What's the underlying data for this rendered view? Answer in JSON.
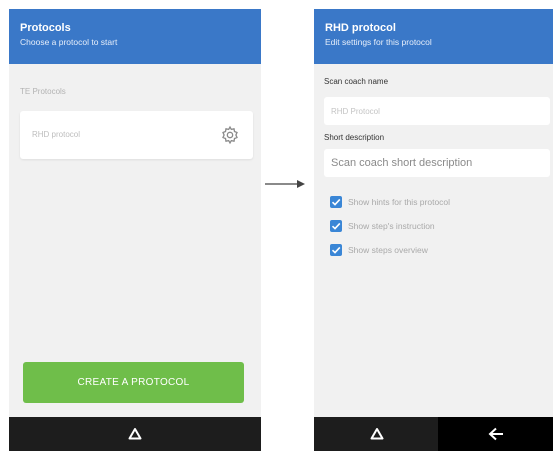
{
  "left_screen": {
    "appbar": {
      "title": "Protocols",
      "subtitle": "Choose a protocol to start"
    },
    "section_label": "TE Protocols",
    "protocol_card": {
      "name": "RHD protocol",
      "icon": "gear-icon"
    },
    "create_button_label": "CREATE A PROTOCOL",
    "navbar": {
      "home_icon": "home-icon"
    }
  },
  "transition_arrow": {
    "icon": "arrow-right-icon"
  },
  "right_screen": {
    "appbar": {
      "title": "RHD protocol",
      "subtitle": "Edit settings for this protocol"
    },
    "scan_coach_name": {
      "label": "Scan coach name",
      "placeholder": "RHD Protocol",
      "value": ""
    },
    "short_description": {
      "label": "Short description",
      "placeholder": "Scan coach short description",
      "value": ""
    },
    "options": [
      {
        "label": "Show hints for this protocol",
        "checked": true
      },
      {
        "label": "Show step's instruction",
        "checked": true
      },
      {
        "label": "Show steps overview",
        "checked": true
      }
    ],
    "navbar": {
      "home_icon": "home-icon",
      "back_icon": "back-arrow-icon"
    }
  },
  "colors": {
    "appbar": "#3a78c8",
    "create_button": "#6fbe4a",
    "checkbox": "#3a86d6",
    "navbar": "#1d1d1d",
    "screen_background": "#f1f1f1"
  }
}
